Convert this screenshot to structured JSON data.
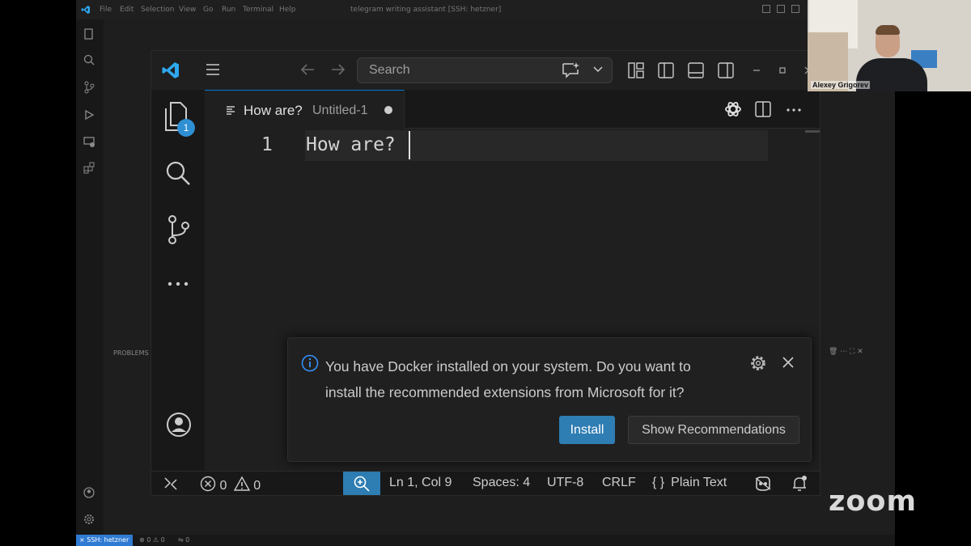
{
  "background_window": {
    "menu": [
      "File",
      "Edit",
      "Selection",
      "View",
      "Go",
      "Run",
      "Terminal",
      "Help"
    ],
    "title": "telegram writing assistant [SSH: hetzner]",
    "panel_label": "PROBLEMS",
    "status": {
      "remote": "SSH: hetzner",
      "errors": "0",
      "warnings": "0",
      "ports": "0"
    }
  },
  "titlebar": {
    "search_placeholder": "Search"
  },
  "activity_bar": {
    "explorer_badge": "1"
  },
  "tab": {
    "label": "How are?",
    "description": "Untitled-1"
  },
  "editor": {
    "line_number": "1",
    "line_text": "How are?"
  },
  "notification": {
    "message": "You have Docker installed on your system. Do you want to install the recommended extensions from Microsoft for it?",
    "primary_button": "Install",
    "secondary_button": "Show Recommendations"
  },
  "status_bar": {
    "errors": "0",
    "warnings": "0",
    "position": "Ln 1, Col 9",
    "spaces": "Spaces: 4",
    "encoding": "UTF-8",
    "eol": "CRLF",
    "language": "Plain Text",
    "language_icon": "{ }"
  },
  "video": {
    "participant_name": "Alexey Grigorev"
  },
  "zoom_logo": "zoom",
  "colors": {
    "accent": "#0078d4",
    "install_button": "#2e7db3",
    "badge": "#2e8fd3",
    "vscode_logo": "#2ea8ef"
  }
}
